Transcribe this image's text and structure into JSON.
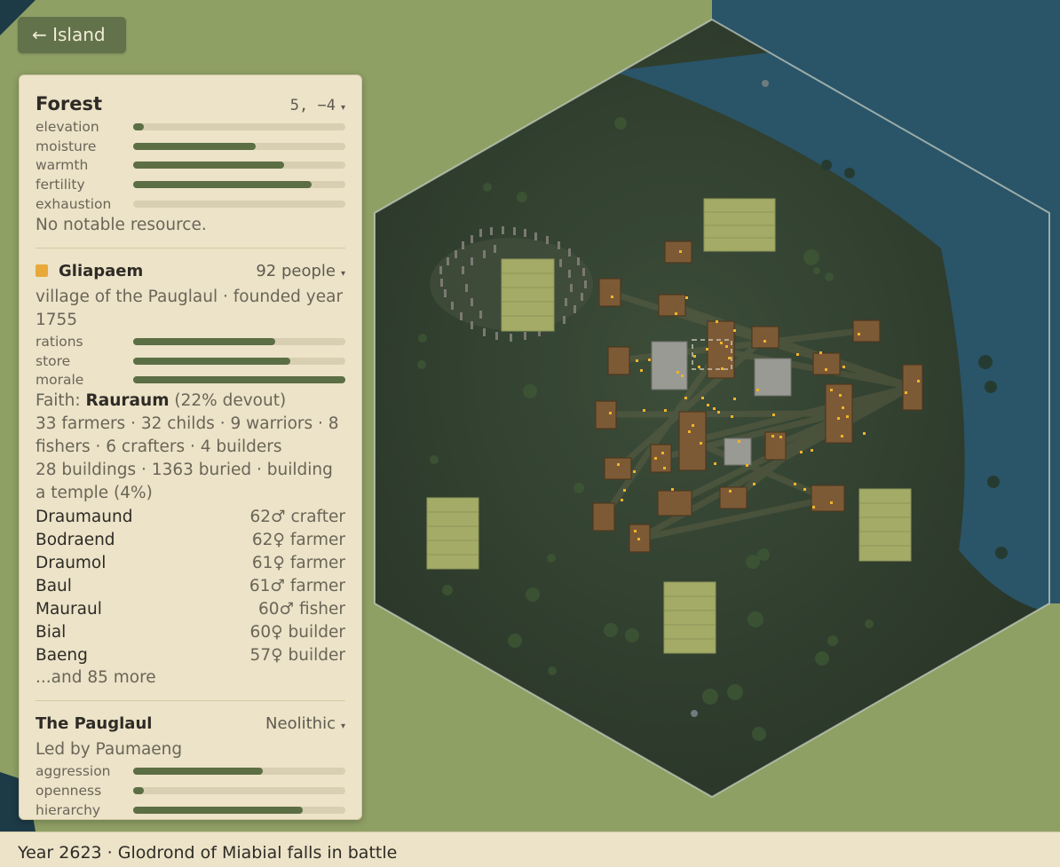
{
  "nav": {
    "back_label": "← Island"
  },
  "tile": {
    "title": "Forest",
    "coords": "5, −4",
    "stats": [
      {
        "label": "elevation",
        "value": 0.05
      },
      {
        "label": "moisture",
        "value": 0.58
      },
      {
        "label": "warmth",
        "value": 0.71
      },
      {
        "label": "fertility",
        "value": 0.84
      },
      {
        "label": "exhaustion",
        "value": 0.0
      }
    ],
    "resource_note": "No notable resource."
  },
  "settlement": {
    "name": "Gliapaem",
    "population": "92 people",
    "color": "#e8a93a",
    "description": "village of the Pauglaul · founded year 1755",
    "stats": [
      {
        "label": "rations",
        "value": 0.67
      },
      {
        "label": "store",
        "value": 0.74
      },
      {
        "label": "morale",
        "value": 1.0
      }
    ],
    "faith_prefix": "Faith: ",
    "faith_name": "Rauraum",
    "faith_suffix": " (22% devout)",
    "occupations": "33 farmers · 32 childs · 9 warriors · 8 fishers · 6 crafters · 4 builders",
    "buildings": "28 buildings · 1363 buried · building a temple (4%)",
    "people": [
      {
        "name": "Draumaund",
        "info": "62♂ crafter"
      },
      {
        "name": "Bodraend",
        "info": "62♀ farmer"
      },
      {
        "name": "Draumol",
        "info": "61♀ farmer"
      },
      {
        "name": "Baul",
        "info": "61♂ farmer"
      },
      {
        "name": "Mauraul",
        "info": "60♂ fisher"
      },
      {
        "name": "Bial",
        "info": "60♀ builder"
      },
      {
        "name": "Baeng",
        "info": "57♀ builder"
      }
    ],
    "more": "...and 85 more"
  },
  "culture": {
    "name": "The Pauglaul",
    "era": "Neolithic",
    "leader": "Led by Paumaeng",
    "stats": [
      {
        "label": "aggression",
        "value": 0.61
      },
      {
        "label": "openness",
        "value": 0.05
      },
      {
        "label": "hierarchy",
        "value": 0.8
      }
    ]
  },
  "status": {
    "message": "Year 2623 · Glodrond of Miabial falls in battle"
  },
  "colors": {
    "grassland": "#8fa065",
    "water": "#2a5468",
    "forest_floor": "#2f3d2e",
    "building": "#7d5a36",
    "field": "#a3ab66",
    "person_dot": "#f0b429",
    "panel_bg": "#ece3c8",
    "bar_fill": "#5c6e44"
  }
}
